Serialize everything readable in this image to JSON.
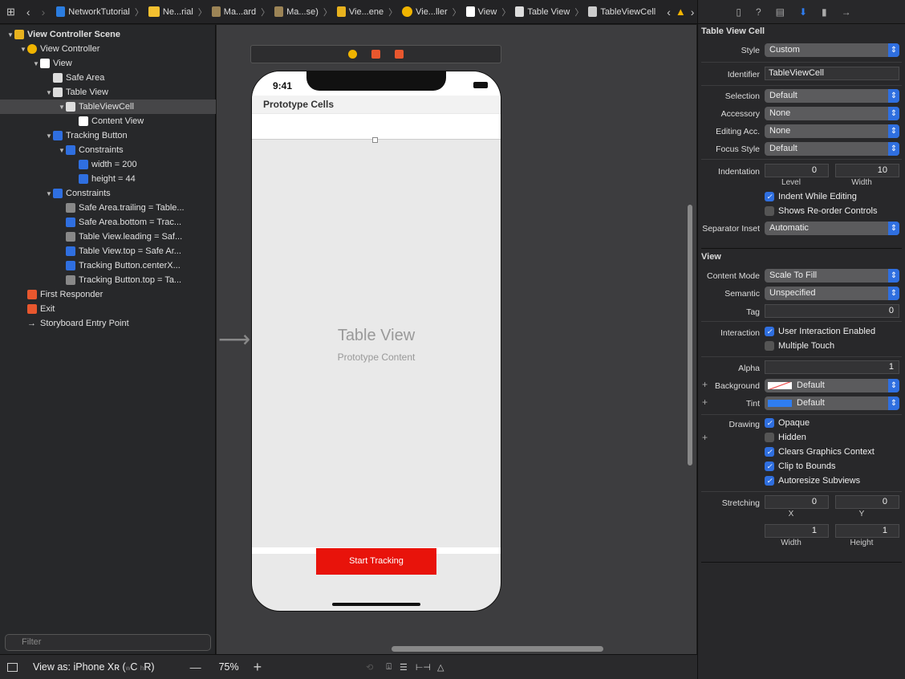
{
  "breadcrumbs": [
    "NetworkTutorial",
    "Ne...rial",
    "Ma...ard",
    "Ma...se)",
    "Vie...ene",
    "Vie...ller",
    "View",
    "Table View",
    "TableViewCell"
  ],
  "navigator": {
    "items": [
      {
        "label": "View Controller Scene",
        "depth": 0,
        "bold": true,
        "color": "#e8b21e"
      },
      {
        "label": "View Controller",
        "depth": 1,
        "color": "#f0b400"
      },
      {
        "label": "View",
        "depth": 2,
        "color": "#ffffff"
      },
      {
        "label": "Safe Area",
        "depth": 3,
        "color": "#dddddd"
      },
      {
        "label": "Table View",
        "depth": 3,
        "color": "#dddddd"
      },
      {
        "label": "TableViewCell",
        "depth": 4,
        "color": "#dddddd",
        "selected": true
      },
      {
        "label": "Content View",
        "depth": 5,
        "color": "#ffffff"
      },
      {
        "label": "Tracking Button",
        "depth": 3,
        "color": "#2f6fe0"
      },
      {
        "label": "Constraints",
        "depth": 4,
        "color": "#2f6fe0"
      },
      {
        "label": "width = 200",
        "depth": 5,
        "color": "#2f6fe0"
      },
      {
        "label": "height = 44",
        "depth": 5,
        "color": "#2f6fe0"
      },
      {
        "label": "Constraints",
        "depth": 3,
        "color": "#2f6fe0"
      },
      {
        "label": "Safe Area.trailing = Table...",
        "depth": 4,
        "color": "#888888"
      },
      {
        "label": "Safe Area.bottom = Trac...",
        "depth": 4,
        "color": "#2f6fe0"
      },
      {
        "label": "Table View.leading = Saf...",
        "depth": 4,
        "color": "#888888"
      },
      {
        "label": "Table View.top = Safe Ar...",
        "depth": 4,
        "color": "#2f6fe0"
      },
      {
        "label": "Tracking Button.centerX...",
        "depth": 4,
        "color": "#2f6fe0"
      },
      {
        "label": "Tracking Button.top = Ta...",
        "depth": 4,
        "color": "#888888"
      },
      {
        "label": "First Responder",
        "depth": 1,
        "color": "#e8572e"
      },
      {
        "label": "Exit",
        "depth": 1,
        "color": "#e8572e"
      },
      {
        "label": "Storyboard Entry Point",
        "depth": 1,
        "color": "none"
      }
    ],
    "filter_placeholder": "Filter"
  },
  "canvas": {
    "time": "9:41",
    "prototype_cells": "Prototype Cells",
    "table_view": "Table View",
    "prototype_content": "Prototype Content",
    "button": "Start Tracking",
    "button_color": "#e8130b"
  },
  "bottom": {
    "view_as": "View as: iPhone Xʀ (",
    "w": "w",
    "c": "C",
    "h": "h",
    "r": "R)",
    "zoom": "75%"
  },
  "inspector": {
    "cell_section": "Table View Cell",
    "style_label": "Style",
    "style": "Custom",
    "identifier_label": "Identifier",
    "identifier": "TableViewCell",
    "selection_label": "Selection",
    "selection": "Default",
    "accessory_label": "Accessory",
    "accessory": "None",
    "editing_label": "Editing Acc.",
    "editing": "None",
    "focus_label": "Focus Style",
    "focus": "Default",
    "indentation_label": "Indentation",
    "level": "0",
    "level_label": "Level",
    "width": "10",
    "width_label": "Width",
    "indent_editing": "Indent While Editing",
    "reorder": "Shows Re-order Controls",
    "separator_label": "Separator Inset",
    "separator": "Automatic",
    "view_section": "View",
    "content_mode_label": "Content Mode",
    "content_mode": "Scale To Fill",
    "semantic_label": "Semantic",
    "semantic": "Unspecified",
    "tag_label": "Tag",
    "tag": "0",
    "interaction_label": "Interaction",
    "user_interaction": "User Interaction Enabled",
    "multiple_touch": "Multiple Touch",
    "alpha_label": "Alpha",
    "alpha": "1",
    "background_label": "Background",
    "background": "Default",
    "tint_label": "Tint",
    "tint": "Default",
    "drawing_label": "Drawing",
    "opaque": "Opaque",
    "hidden": "Hidden",
    "clears": "Clears Graphics Context",
    "clip": "Clip to Bounds",
    "autoresize": "Autoresize Subviews",
    "stretching_label": "Stretching",
    "sx": "0",
    "sy": "0",
    "sw": "1",
    "sh": "1",
    "x_label": "X",
    "y_label": "Y",
    "w_label": "Width",
    "h_label": "Height"
  }
}
